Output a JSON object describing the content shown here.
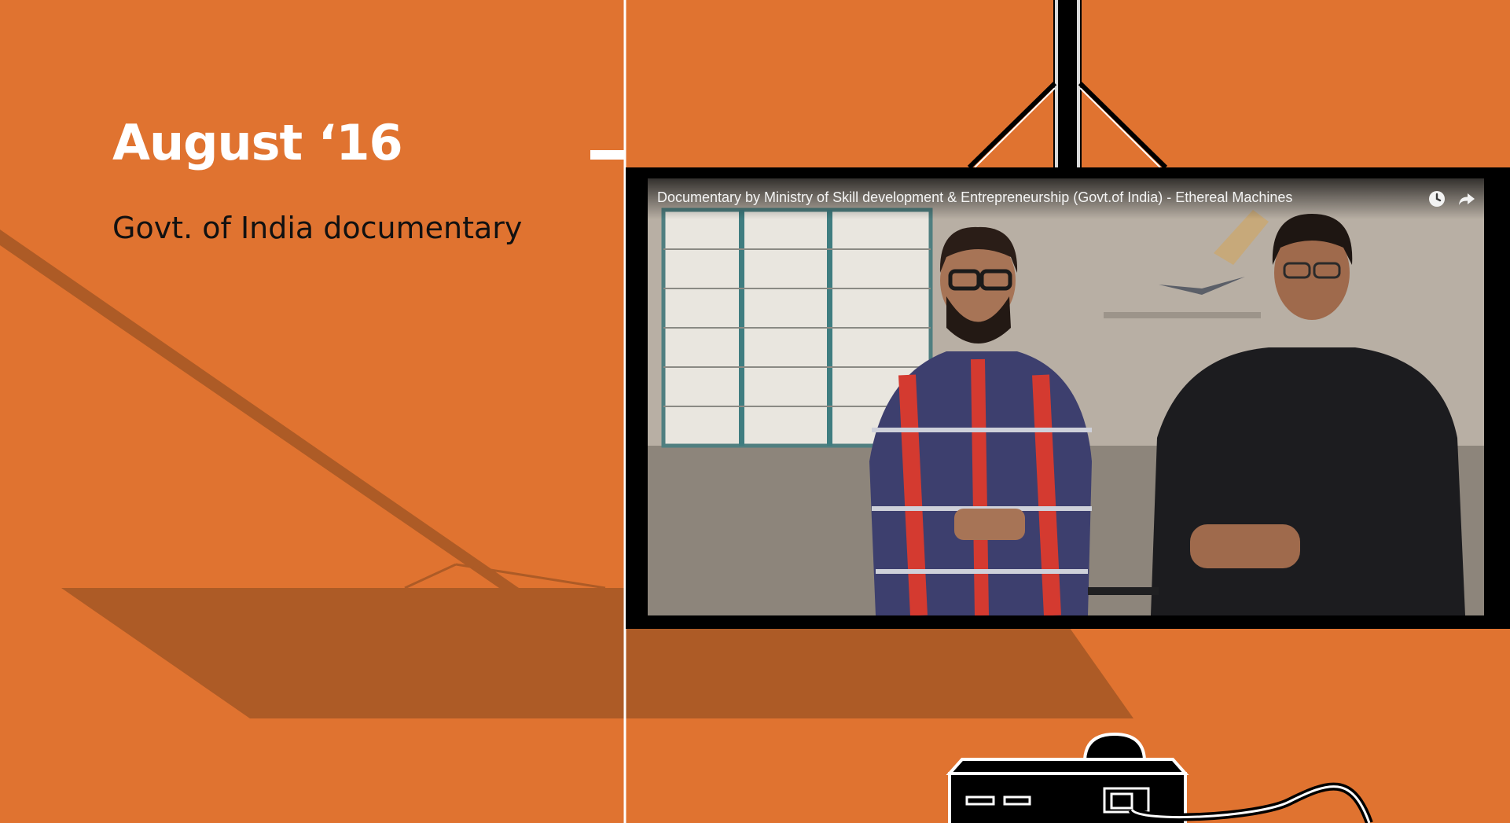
{
  "slide": {
    "heading": "August ‘16",
    "subheading": "Govt. of India documentary"
  },
  "video": {
    "title": "Documentary by Ministry of Skill development & Entrepreneurship (Govt.of India) - Ethereal Machines",
    "controls": {
      "watch_later_icon": "clock-icon",
      "share_icon": "share-arrow-icon"
    }
  },
  "colors": {
    "background": "#E07330",
    "shadow": "#AD5B26",
    "heading": "#FFFFFF",
    "subheading": "#111111",
    "frame": "#000000"
  }
}
